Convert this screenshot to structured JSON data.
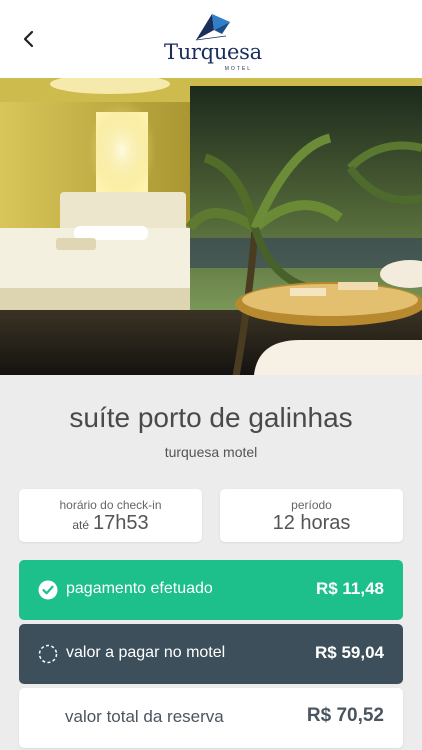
{
  "header": {
    "logo_word": "Turquesa",
    "logo_sub": "MOTEL"
  },
  "suite": {
    "title": "suíte porto de galinhas",
    "subtitle": "turquesa motel"
  },
  "checkin": {
    "label": "horário do check-in",
    "prefix": "até",
    "value": "17h53"
  },
  "periodo": {
    "label": "período",
    "value": "12 horas"
  },
  "payments": {
    "paid_label": "pagamento efetuado",
    "paid_amount": "R$ 11,48",
    "due_label": "valor a pagar no motel",
    "due_amount": "R$ 59,04",
    "total_label": "valor total da reserva",
    "total_amount": "R$ 70,52"
  },
  "colors": {
    "paid": "#1dbf8a",
    "due": "#3c4f5b",
    "brand": "#1a2e5c"
  },
  "icons": {
    "back": "chevron-left-icon",
    "paid": "check-circle-icon",
    "due": "dashed-circle-icon"
  }
}
